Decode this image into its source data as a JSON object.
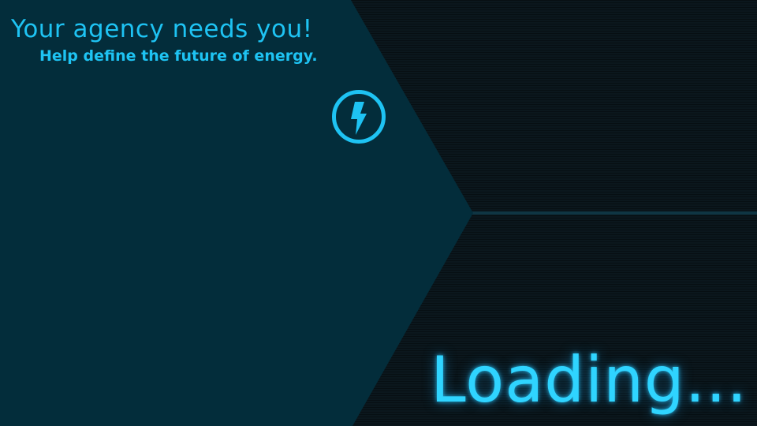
{
  "screen": {
    "headline": "Your agency needs you!",
    "subline": "Help define the future of energy.",
    "loading": "Loading..."
  },
  "icons": {
    "emblem": "lightning-bolt-icon"
  },
  "colors": {
    "accent": "#1ec3f3",
    "panel": "#032d3b",
    "background": "#0b171d",
    "divider": "#0f3543"
  }
}
